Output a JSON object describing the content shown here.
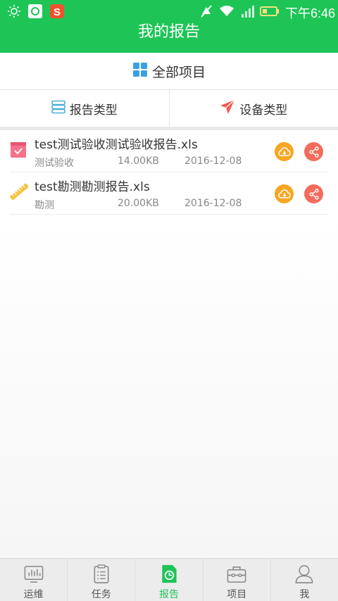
{
  "status": {
    "time": "下午6:46"
  },
  "header": {
    "title": "我的报告"
  },
  "filters": {
    "all_projects": "全部项目",
    "report_type": "报告类型",
    "device_type": "设备类型"
  },
  "reports": [
    {
      "name": "test测试验收测试验收报告.xls",
      "category": "测试验收",
      "size": "14.00KB",
      "date": "2016-12-08",
      "icon": "checklist-icon"
    },
    {
      "name": "test勘测勘测报告.xls",
      "category": "勘测",
      "size": "20.00KB",
      "date": "2016-12-08",
      "icon": "ruler-icon"
    }
  ],
  "tabs": [
    {
      "label": "运维",
      "icon": "monitor-chart-icon"
    },
    {
      "label": "任务",
      "icon": "clipboard-icon"
    },
    {
      "label": "报告",
      "icon": "report-icon",
      "active": true
    },
    {
      "label": "项目",
      "icon": "toolbox-icon"
    },
    {
      "label": "我",
      "icon": "person-icon"
    }
  ],
  "colors": {
    "primary": "#1ec556",
    "download": "#f6a623",
    "share": "#f46b5c"
  }
}
